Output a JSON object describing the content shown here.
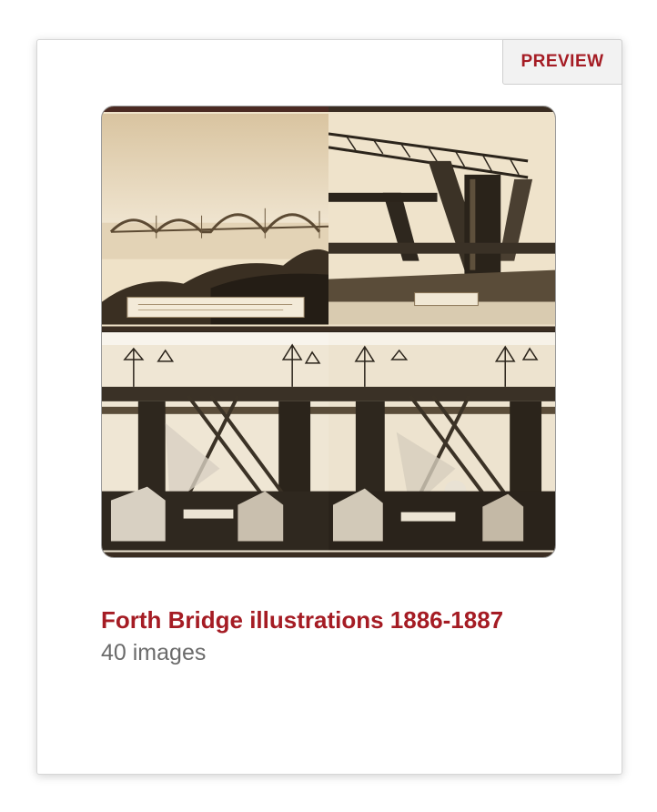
{
  "collection": {
    "preview_label": "PREVIEW",
    "title": "Forth Bridge illustrations 1886-1887",
    "count_text": "40 images"
  },
  "thumbnails": [
    {
      "name": "bridge-panorama-photo",
      "tone": "sepia"
    },
    {
      "name": "cantilever-tower-construction-photo",
      "tone": "sepia"
    },
    {
      "name": "bridge-construction-scaffolding-photo-1",
      "tone": "dark-sepia"
    },
    {
      "name": "bridge-construction-scaffolding-photo-2",
      "tone": "dark-sepia"
    }
  ],
  "colors": {
    "accent": "#a51c24",
    "muted_text": "#6b6b6b",
    "tab_background": "#f2f2f2",
    "sepia_light": "#efe2c8",
    "sepia_dark": "#2b241b"
  }
}
